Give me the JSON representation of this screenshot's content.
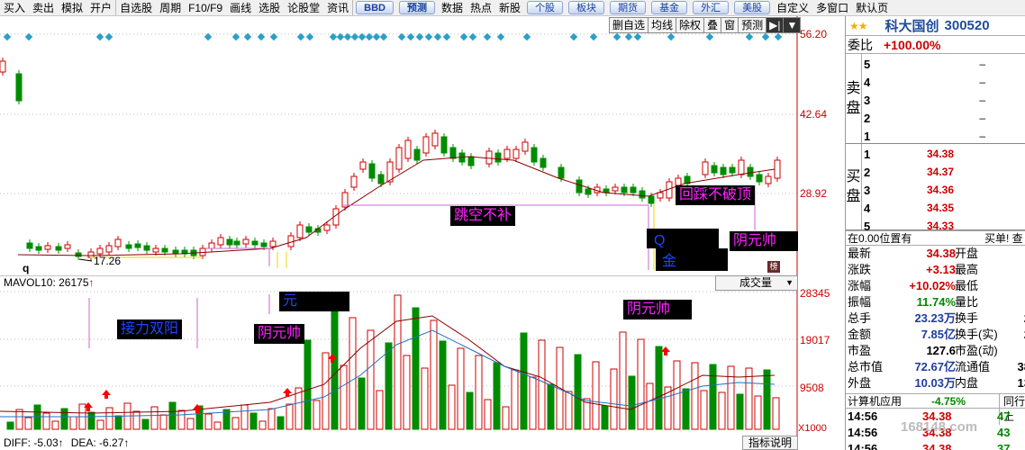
{
  "menu": {
    "items": [
      "买入",
      "卖出",
      "模拟",
      "开户",
      "自选股",
      "周期",
      "F10/F9",
      "画线",
      "选股",
      "论股堂",
      "资讯"
    ],
    "buttons": [
      "BBD",
      "预测"
    ],
    "items2": [
      "数据",
      "热点",
      "新股"
    ],
    "buttons2": [
      "个股",
      "板块",
      "期货",
      "基金",
      "外汇",
      "美股"
    ],
    "items3": [
      "自定义",
      "多窗口",
      "默认页"
    ]
  },
  "toolbar": [
    "删自选",
    "均线",
    "除权",
    "叠",
    "窗",
    "预测",
    "▶|",
    "▼"
  ],
  "stock": {
    "name": "科大国创",
    "code": "300520",
    "stars": "★★"
  },
  "weibi": {
    "label": "委比",
    "value": "+100.00%"
  },
  "sell_side_label": [
    "卖",
    "盘"
  ],
  "buy_side_label": [
    "买",
    "盘"
  ],
  "asks": [
    {
      "level": "5",
      "price": "",
      "vol": "–"
    },
    {
      "level": "4",
      "price": "",
      "vol": "–"
    },
    {
      "level": "3",
      "price": "",
      "vol": "–"
    },
    {
      "level": "2",
      "price": "",
      "vol": "–"
    },
    {
      "level": "1",
      "price": "",
      "vol": "–"
    }
  ],
  "bids": [
    {
      "level": "1",
      "price": "34.38",
      "vol": ""
    },
    {
      "level": "2",
      "price": "34.37",
      "vol": ""
    },
    {
      "level": "3",
      "price": "34.36",
      "vol": ""
    },
    {
      "level": "4",
      "price": "34.35",
      "vol": ""
    },
    {
      "level": "5",
      "price": "34.33",
      "vol": ""
    }
  ],
  "position": {
    "left": "在0.00位置有",
    "right": "买单! 查"
  },
  "stats": [
    {
      "l1": "最新",
      "v1": "34.38",
      "c1": "red",
      "l2": "开盘",
      "v2": ""
    },
    {
      "l1": "涨跌",
      "v1": "+3.13",
      "c1": "red",
      "l2": "最高",
      "v2": ""
    },
    {
      "l1": "涨幅",
      "v1": "+10.02%",
      "c1": "red",
      "l2": "最低",
      "v2": ""
    },
    {
      "l1": "振幅",
      "v1": "11.74%",
      "c1": "green",
      "l2": "量比",
      "v2": ""
    },
    {
      "l1": "总手",
      "v1": "23.23万",
      "c1": "blue-t",
      "l2": "换手",
      "v2": "2"
    },
    {
      "l1": "金额",
      "v1": "7.85亿",
      "c1": "blue-t",
      "l2": "换手(实)",
      "v2": "2"
    },
    {
      "l1": "市盈",
      "v1": "127.6",
      "c1": "",
      "l2": "市盈(动)",
      "v2": ""
    },
    {
      "l1": "总市值",
      "v1": "72.67亿",
      "c1": "blue-t",
      "l2": "流通值",
      "v2": "38"
    },
    {
      "l1": "外盘",
      "v1": "10.03万",
      "c1": "blue-t",
      "l2": "内盘",
      "v2": "13"
    }
  ],
  "calc": {
    "label": "计算机应用",
    "value": "-4.75%",
    "tab": "同行上"
  },
  "ticks": [
    {
      "t": "14:56",
      "p": "34.38",
      "n": "47"
    },
    {
      "t": "14:56",
      "p": "34.38",
      "n": "43"
    },
    {
      "t": "14:56",
      "p": "34.38",
      "n": "37"
    }
  ],
  "axis_main": [
    "56.20",
    "42.64",
    "28.92"
  ],
  "axis_vol": [
    "28345",
    "19017",
    "9508"
  ],
  "x_unit": "X1000",
  "price_low_label": "17.26",
  "q_mark": "q",
  "logo_tag": "榜",
  "vol_label": {
    "text": "MAVOL10: 26175",
    "arrow": "↑"
  },
  "macd_label": {
    "diff": "DIFF: -5.03↑",
    "dea": "DEA: -6.27↑"
  },
  "indicator_btn": "指标说明",
  "volume_select": "成交量",
  "annotations": {
    "gap": "跳空不补",
    "pullback": "回踩不破顶",
    "yin1": "阴元帅",
    "yin2": "阴元帅",
    "yin3": "阴元帅",
    "relay": "接力双阳",
    "yuan": "元",
    "jin": "金",
    "q2": "Q"
  },
  "watermark": "168148.com",
  "colors": {
    "up": "#cc0000",
    "down": "#008c00",
    "ma1": "#8b0000",
    "ma2": "#2070c0",
    "diamond": "#2aa0c8"
  }
}
